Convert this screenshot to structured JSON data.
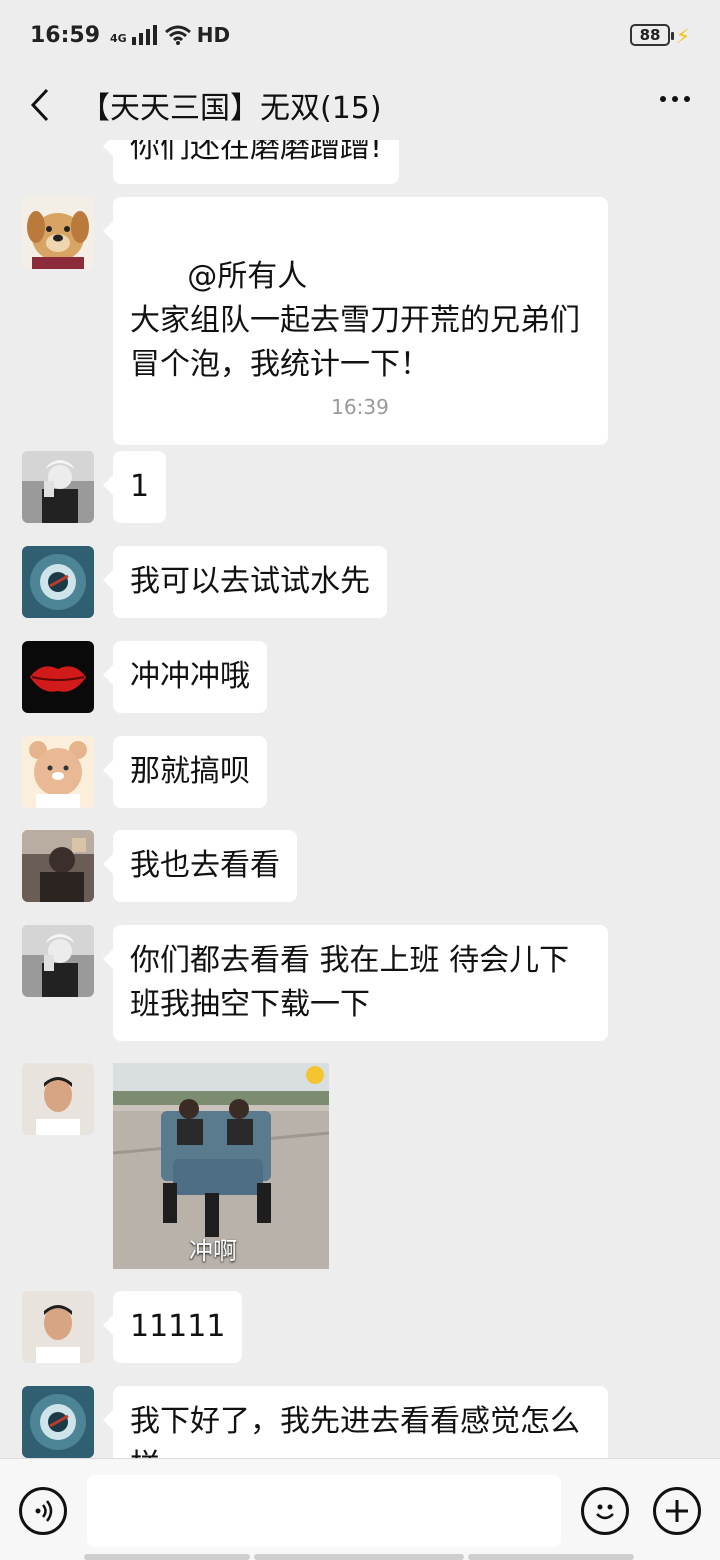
{
  "status_bar": {
    "time": "16:59",
    "network": "4G",
    "hd": "HD",
    "battery": "88"
  },
  "header": {
    "title": "【天天三国】无双(15)"
  },
  "messages": [
    {
      "text": "你们还在磨磨蹭蹭!"
    },
    {
      "text": "@所有人\n大家组队一起去雪刀开荒的兄弟们冒个泡，我统计一下！"
    },
    {
      "text": "1"
    },
    {
      "text": "我可以去试试水先"
    },
    {
      "text": "冲冲冲哦"
    },
    {
      "text": "那就搞呗"
    },
    {
      "text": "我也去看看"
    },
    {
      "text": "你们都去看看 我在上班 待会儿下班我抽空下载一下"
    },
    {
      "caption": "冲啊"
    },
    {
      "text": "11111"
    },
    {
      "text": "我下好了，我先进去看看感觉怎么样"
    }
  ],
  "timestamp": "16:39",
  "input": {
    "placeholder": ""
  },
  "icons": {
    "back": "chevron-left-icon",
    "more": "more-dots-icon",
    "voice": "voice-icon",
    "emoji": "emoji-icon",
    "plus": "plus-icon"
  }
}
